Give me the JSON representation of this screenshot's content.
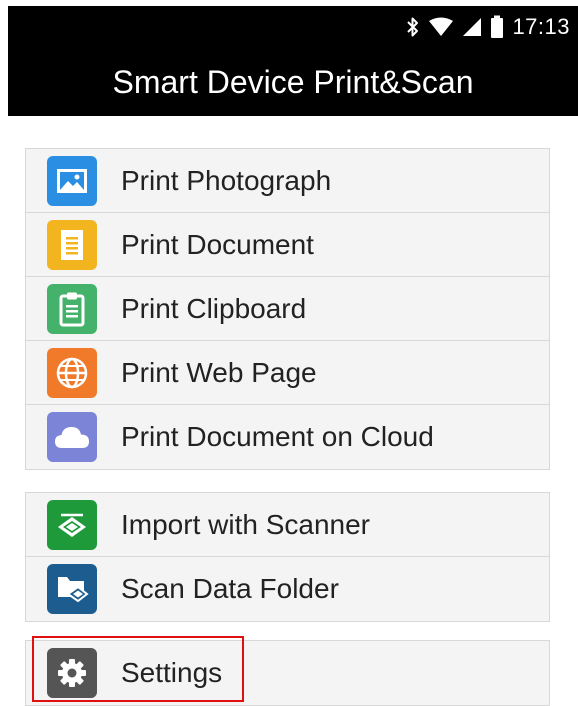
{
  "status_bar": {
    "time": "17:13",
    "icons": [
      "bluetooth-icon",
      "wifi-icon",
      "signal-icon",
      "battery-icon"
    ]
  },
  "app_bar": {
    "title": "Smart Device Print&Scan"
  },
  "print_group": {
    "items": [
      {
        "label": "Print Photograph",
        "icon": "photo-icon",
        "color": "#2a8ee2"
      },
      {
        "label": "Print Document",
        "icon": "document-icon",
        "color": "#f2b51f"
      },
      {
        "label": "Print Clipboard",
        "icon": "clipboard-icon",
        "color": "#45b26b"
      },
      {
        "label": "Print Web Page",
        "icon": "globe-icon",
        "color": "#f07a2a"
      },
      {
        "label": "Print Document on Cloud",
        "icon": "cloud-icon",
        "color": "#7b84d6"
      }
    ]
  },
  "scan_group": {
    "items": [
      {
        "label": "Import with Scanner",
        "icon": "scanner-icon",
        "color": "#1f9a3a"
      },
      {
        "label": "Scan Data Folder",
        "icon": "folder-icon",
        "color": "#1c5c8f"
      }
    ]
  },
  "settings_group": {
    "items": [
      {
        "label": "Settings",
        "icon": "gear-icon",
        "color": "#555555"
      }
    ]
  },
  "colors": {
    "bar_background": "#000000",
    "list_background": "#f4f4f4",
    "divider": "#d8d8d8",
    "highlight": "#e01010"
  }
}
